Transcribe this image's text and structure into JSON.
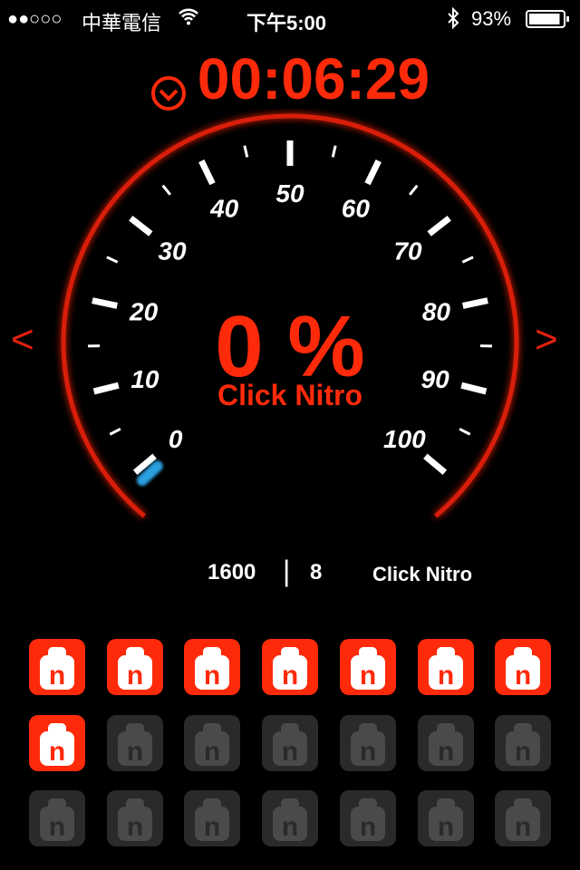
{
  "status_bar": {
    "signal": "●●○○○",
    "carrier": "中華電信",
    "time": "下午5:00",
    "battery": "93%",
    "battery_level": 0.93
  },
  "timer": {
    "value": "00:06:29",
    "icon": "clock-icon"
  },
  "gauge": {
    "min": 0,
    "max": 100,
    "labels": [
      "0",
      "10",
      "20",
      "30",
      "40",
      "50",
      "60",
      "70",
      "80",
      "90",
      "100"
    ],
    "value_percent": 0,
    "colors": {
      "accent": "#ff2a0a",
      "arc": "#d81e0a",
      "needle": "#2aa0e0"
    }
  },
  "center": {
    "percent": "0 %",
    "label": "Click Nitro"
  },
  "nav": {
    "prev": "<",
    "next": ">"
  },
  "stats": {
    "score": "1600",
    "separator": "|",
    "count": "8",
    "action": "Click Nitro"
  },
  "nitro": {
    "total": 21,
    "active": 8,
    "letter": "n",
    "active_color": "#ff2a0a",
    "inactive_color": "#2a2a2a"
  }
}
